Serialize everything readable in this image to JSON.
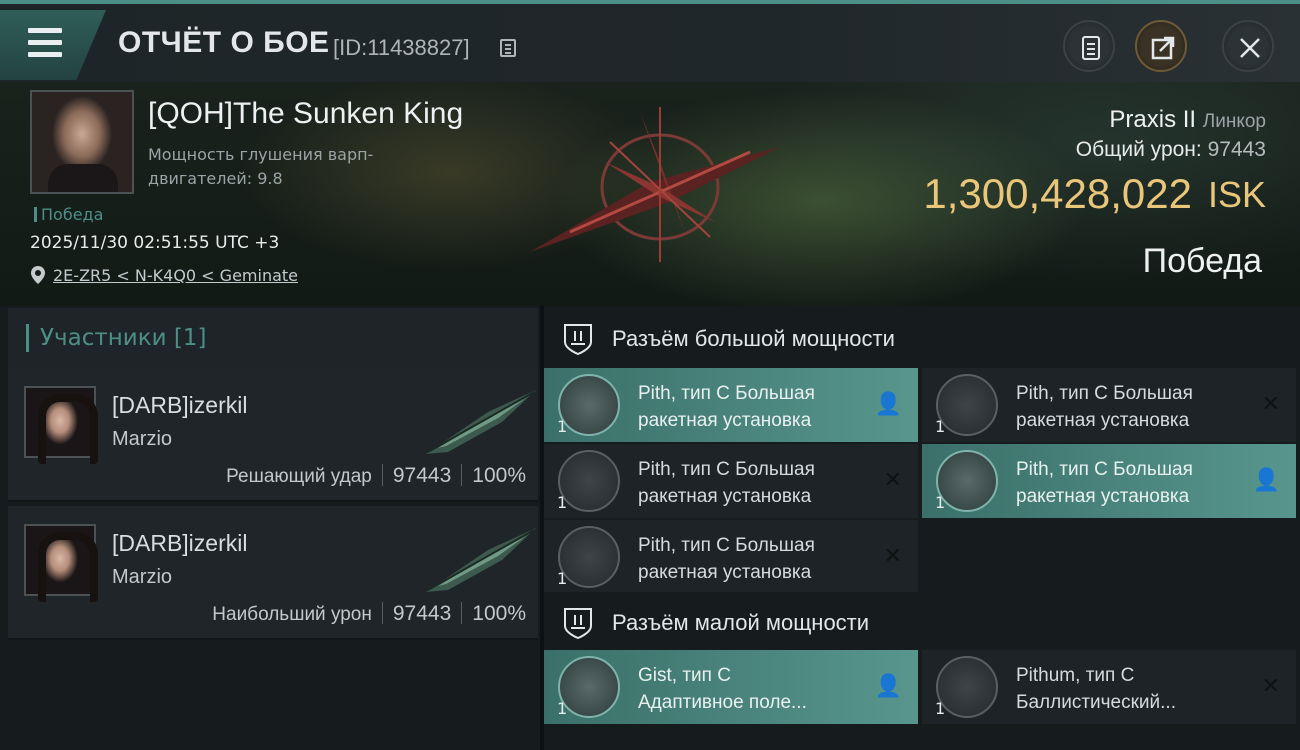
{
  "header": {
    "title": "ОТЧЁТ О БОЕ",
    "id": "[ID:11438827]",
    "icons": [
      "menu-icon",
      "copy-icon",
      "report-icon",
      "share-icon",
      "close-icon"
    ]
  },
  "victim": {
    "name": "[QOH]The Sunken King",
    "jam_label": "Мощность глушения варп-двигателей: 9.8",
    "victory_tag": "Победа",
    "datetime": "2025/11/30 02:51:55 UTC +3",
    "location": "2E-ZR5 < N-K4Q0 < Geminate",
    "ship": "Praxis II",
    "ship_class": "Линкор",
    "total_damage_label": "Общий урон:",
    "total_damage": "97443",
    "isk_value": "1,300,428,022",
    "isk_unit": "ISK",
    "result": "Победа"
  },
  "participants": {
    "header": "Участники [1]",
    "items": [
      {
        "name": "[DARB]izerkil",
        "ship": "Marzio",
        "role": "Решающий удар",
        "damage": "97443",
        "percent": "100%"
      },
      {
        "name": "[DARB]izerkil",
        "ship": "Marzio",
        "role": "Наибольший урон",
        "damage": "97443",
        "percent": "100%"
      }
    ]
  },
  "high_slots": {
    "title": "Разъём большой мощности",
    "items": [
      {
        "line1": "Pith, тип C Большая",
        "line2": "ракетная установка",
        "qty": "1",
        "status": "dropped",
        "mark": "👤"
      },
      {
        "line1": "Pith, тип C Большая",
        "line2": "ракетная установка",
        "qty": "1",
        "status": "destroyed",
        "mark": "✕"
      },
      {
        "line1": "Pith, тип C Большая",
        "line2": "ракетная установка",
        "qty": "1",
        "status": "destroyed",
        "mark": "✕"
      },
      {
        "line1": "Pith, тип C Большая",
        "line2": "ракетная установка",
        "qty": "1",
        "status": "dropped",
        "mark": "👤"
      },
      {
        "line1": "Pith, тип C Большая",
        "line2": "ракетная установка",
        "qty": "1",
        "status": "destroyed",
        "mark": "✕"
      }
    ]
  },
  "low_slots": {
    "title": "Разъём малой мощности",
    "items": [
      {
        "line1": "Gist, тип C",
        "line2": "Адаптивное поле...",
        "qty": "1",
        "status": "dropped",
        "mark": "👤"
      },
      {
        "line1": "Pithum, тип C",
        "line2": "Баллистический...",
        "qty": "1",
        "status": "destroyed",
        "mark": "✕"
      }
    ]
  },
  "colors": {
    "accent": "#4d8f86",
    "isk": "#e9c67a",
    "dropped_bg": "#58968d",
    "destroyed_bg": "#1d2326"
  }
}
